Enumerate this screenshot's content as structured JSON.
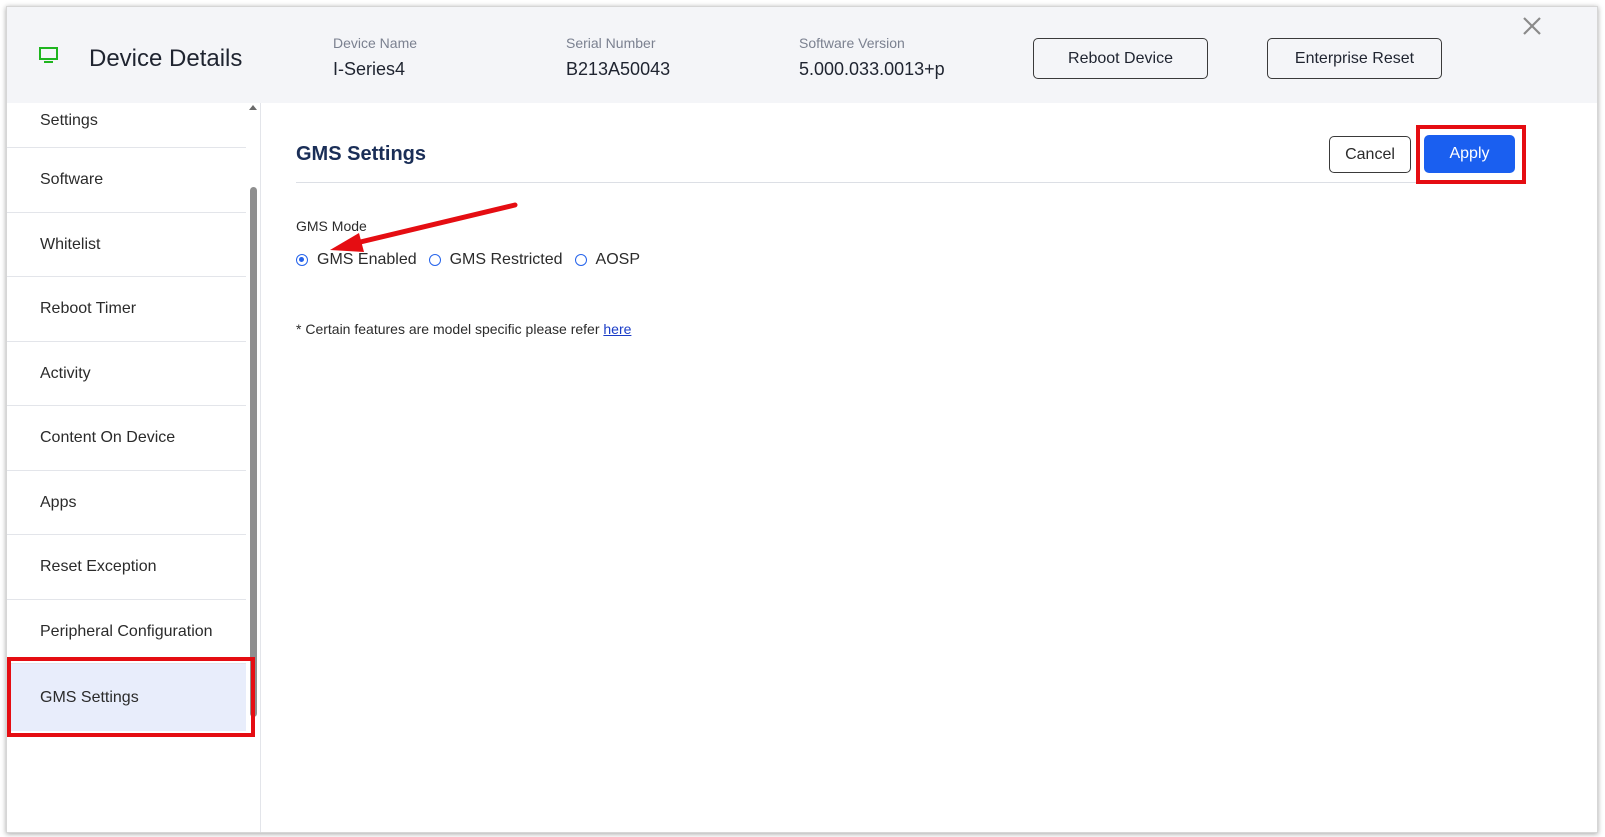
{
  "header": {
    "title": "Device Details",
    "device_name_label": "Device Name",
    "device_name": "I-Series4",
    "serial_label": "Serial Number",
    "serial": "B213A50043",
    "software_label": "Software Version",
    "software": "5.000.033.0013+p",
    "reboot_label": "Reboot Device",
    "enterprise_reset_label": "Enterprise Reset"
  },
  "sidebar": {
    "items": [
      {
        "label": "Settings"
      },
      {
        "label": "Software"
      },
      {
        "label": "Whitelist"
      },
      {
        "label": "Reboot Timer"
      },
      {
        "label": "Activity"
      },
      {
        "label": "Content On Device"
      },
      {
        "label": "Apps"
      },
      {
        "label": "Reset Exception"
      },
      {
        "label": "Peripheral Configuration"
      },
      {
        "label": "GMS Settings"
      }
    ],
    "active": "GMS Settings"
  },
  "main": {
    "title": "GMS Settings",
    "cancel_label": "Cancel",
    "apply_label": "Apply",
    "gms_mode_label": "GMS Mode",
    "options": [
      {
        "label": "GMS Enabled",
        "checked": true
      },
      {
        "label": "GMS Restricted",
        "checked": false
      },
      {
        "label": "AOSP",
        "checked": false
      }
    ],
    "note_text": "* Certain features are model specific please refer ",
    "note_link": "here"
  },
  "colors": {
    "accent": "#1a5ff0",
    "highlight": "#e50d12",
    "active_bg": "#e8edfb",
    "title_navy": "#1a2e57",
    "device_icon": "#1fb51f"
  },
  "icons": {
    "device": "monitor-icon",
    "close": "close-icon"
  }
}
